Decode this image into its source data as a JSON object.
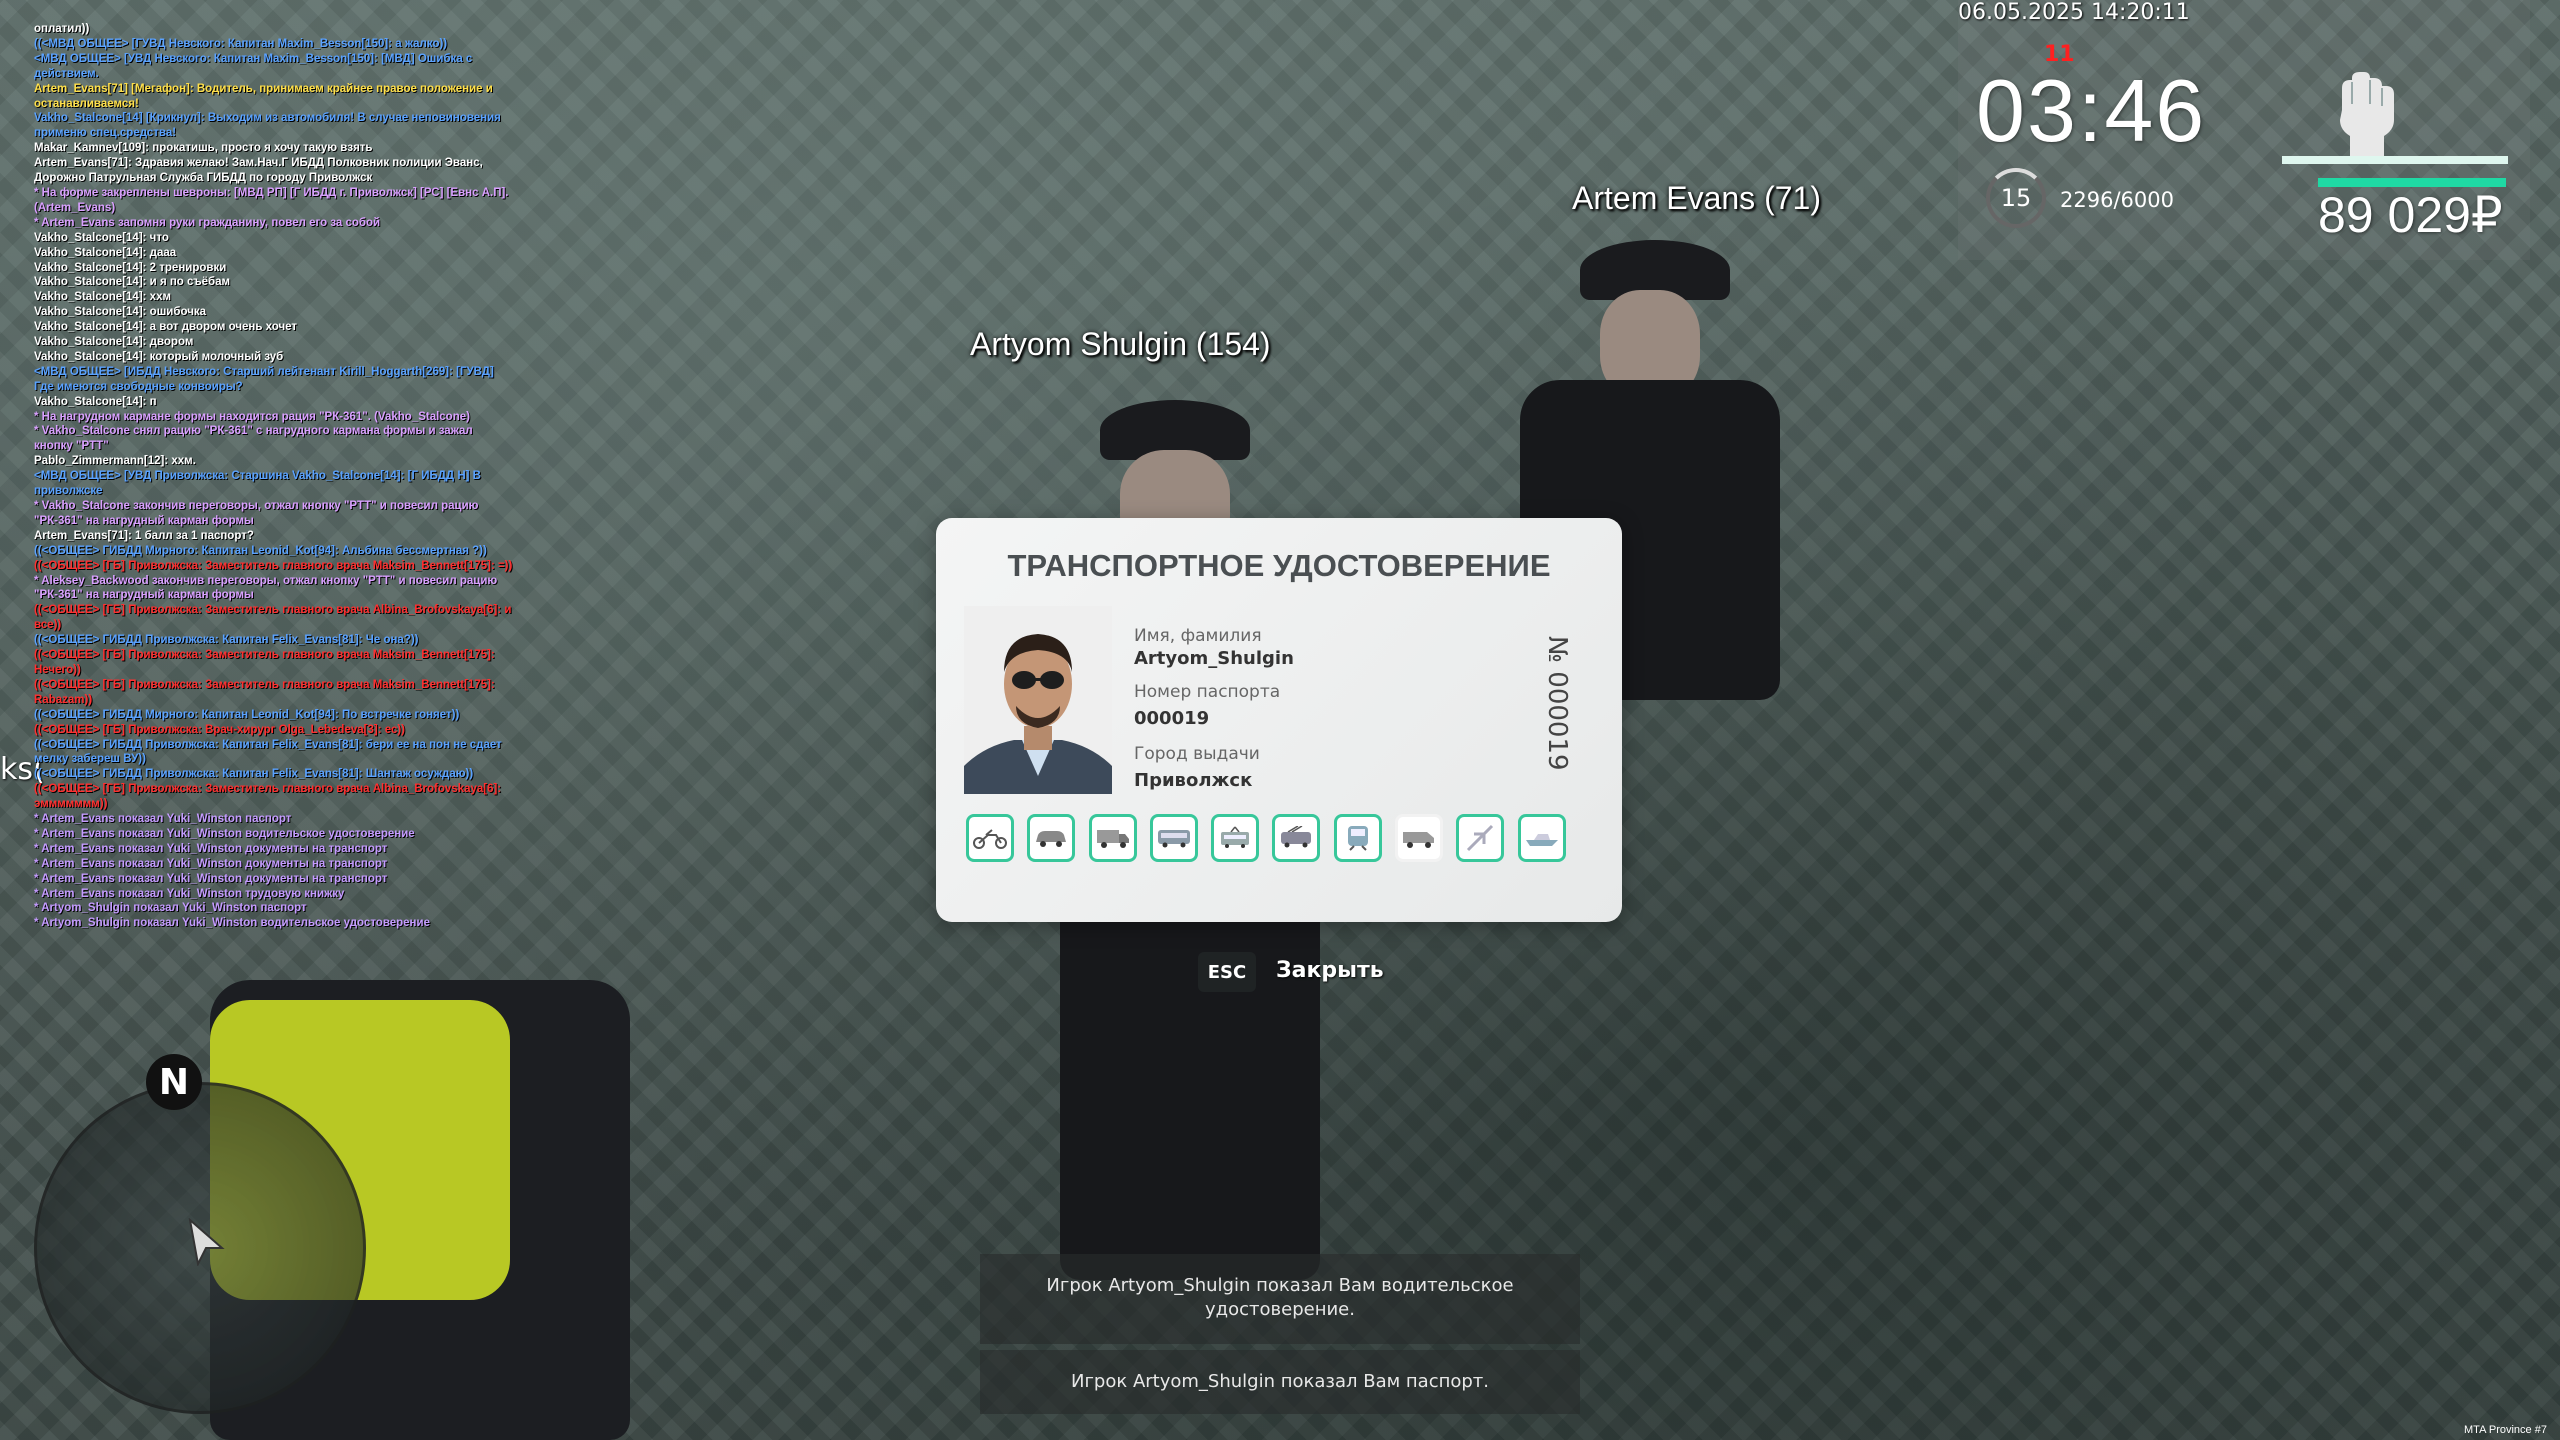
{
  "hud": {
    "datetime": "06.05.2025 14:20:11",
    "alert": "11",
    "clock": "03:46",
    "level": "15",
    "exp": "2296/6000",
    "money": "89 029₽",
    "accent_color": "#1fd9a4"
  },
  "players": [
    {
      "name": "Artyom Shulgin (154)"
    },
    {
      "name": "Artem Evans (71)"
    }
  ],
  "stray_text": "ks(",
  "chat": [
    {
      "c": "white",
      "t": "оплатил))"
    },
    {
      "c": "blue",
      "t": "((<МВД ОБЩЕЕ> [ГУВД Невского: Капитан Maxim_Besson[150]: а жалко))"
    },
    {
      "c": "blue",
      "t": "<МВД ОБЩЕЕ> [УВД Невского: Капитан Maxim_Besson[150]: [МВД] Ошибка с действием."
    },
    {
      "c": "yellow",
      "t": "Artem_Evans[71] [Мегафон]: Водитель, принимаем крайнее правое положение и останавливаемся!"
    },
    {
      "c": "blue",
      "t": "Vakho_Stalcone[14] [Крикнул]: Выходим из автомобиля! В случае неповиновения применю спец.средства!"
    },
    {
      "c": "white",
      "t": "Makar_Kamnev[109]: прокатишь, просто я хочу такую взять"
    },
    {
      "c": "white",
      "t": "Artem_Evans[71]: Здравия желаю! Зам.Нач.Г ИБДД Полковник полиции Эванс, Дорожно Патрульная Служба ГИБДД по городу Приволжск"
    },
    {
      "c": "pink",
      "t": "* На форме закреплены шевроны: [МВД РП] [Г ИБДД г. Приволжск] [РС] [Евнс А.П]. (Artem_Evans)"
    },
    {
      "c": "pink",
      "t": "* Artem_Evans запомня руки гражданину, повел его за собой"
    },
    {
      "c": "white",
      "t": "Vakho_Stalcone[14]: что"
    },
    {
      "c": "white",
      "t": "Vakho_Stalcone[14]: дааа"
    },
    {
      "c": "white",
      "t": "Vakho_Stalcone[14]: 2 тренировки"
    },
    {
      "c": "white",
      "t": "Vakho_Stalcone[14]: и я по съёбам"
    },
    {
      "c": "white",
      "t": "Vakho_Stalcone[14]: ххм"
    },
    {
      "c": "white",
      "t": "Vakho_Stalcone[14]: ошибочка"
    },
    {
      "c": "white",
      "t": "Vakho_Stalcone[14]: а вот двором очень хочет"
    },
    {
      "c": "white",
      "t": "Vakho_Stalcone[14]: двором"
    },
    {
      "c": "white",
      "t": "Vakho_Stalcone[14]: который молочный зуб"
    },
    {
      "c": "blue",
      "t": "<МВД ОБЩЕЕ> [ИБДД Невского: Старший лейтенант Kirill_Hoggarth[269]: [ГУВД] Где имеются свободные конвоиры?"
    },
    {
      "c": "white",
      "t": "Vakho_Stalcone[14]: п"
    },
    {
      "c": "pink",
      "t": "* На нагрудном кармане формы находится рация \"РК-361\". (Vakho_Stalcone)"
    },
    {
      "c": "pink",
      "t": "* Vakho_Stalcone снял рацию \"РК-361\" с нагрудного кармана формы и зажал кнопку \"PTT\""
    },
    {
      "c": "white",
      "t": "Pablo_Zimmermann[12]: ххм."
    },
    {
      "c": "blue",
      "t": "<МВД ОБЩЕЕ> [УВД Приволжска: Старшина Vakho_Stalcone[14]: [Г ИБДД Н] В приволжске"
    },
    {
      "c": "pink",
      "t": "* Vakho_Stalcone закончив переговоры, отжал кнопку \"PTT\" и повесил рацию \"РК-361\" на нагрудный карман формы"
    },
    {
      "c": "white",
      "t": "Artem_Evans[71]: 1 балл за 1 паспорт?"
    },
    {
      "c": "blue",
      "t": "((<ОБЩЕЕ> ГИБДД Мирного: Капитан Leonid_Kot[94]: Альбина бессмертная ?))"
    },
    {
      "c": "red",
      "t": "((<ОБЩЕЕ> [ГБ] Приволжска: Заместитель главного врача Maksim_Bennett[175]: =))"
    },
    {
      "c": "pink",
      "t": "* Aleksey_Backwood закончив переговоры, отжал кнопку \"PTT\" и повесил рацию \"РК-361\" на нагрудный карман формы"
    },
    {
      "c": "red",
      "t": "((<ОБЩЕЕ> [ГБ] Приволжска: Заместитель главного врача Albina_Brofovskaya[6]: и все))"
    },
    {
      "c": "blue",
      "t": "((<ОБЩЕЕ> ГИБДД Приволжска: Капитан Felix_Evans[81]: Че она?))"
    },
    {
      "c": "red",
      "t": "((<ОБЩЕЕ> [ГБ] Приволжска: Заместитель главного врача Maksim_Bennett[175]: Нечего))"
    },
    {
      "c": "red",
      "t": "((<ОБЩЕЕ> [ГБ] Приволжска: Заместитель главного врача Maksim_Bennett[175]: Rabazam))"
    },
    {
      "c": "blue",
      "t": "((<ОБЩЕЕ> ГИБДД Мирного: Капитан Leonid_Kot[94]: По встречке гоняет))"
    },
    {
      "c": "red",
      "t": "((<ОБЩЕЕ> [ГБ] Приволжска: Врач-хирург Olga_Lebedeva[3]: ес))"
    },
    {
      "c": "blue",
      "t": "((<ОБЩЕЕ> ГИБДД Приволжска: Капитан Felix_Evans[81]: бери ее на пон не сдает мелку забереш ВУ))"
    },
    {
      "c": "blue",
      "t": "((<ОБЩЕЕ> ГИБДД Приволжска: Капитан Felix_Evans[81]: Шантаж осуждаю))"
    },
    {
      "c": "red",
      "t": "((<ОБЩЕЕ> [ГБ] Приволжска: Заместитель главного врача Albina_Brofovskaya[6]: эммммммм))"
    },
    {
      "c": "lav",
      "t": "* Artem_Evans показал Yuki_Winston паспорт"
    },
    {
      "c": "lav",
      "t": "* Artem_Evans показал Yuki_Winston водительское удостоверение"
    },
    {
      "c": "lav",
      "t": "* Artem_Evans показал Yuki_Winston документы на транспорт"
    },
    {
      "c": "lav",
      "t": "* Artem_Evans показал Yuki_Winston документы на транспорт"
    },
    {
      "c": "lav",
      "t": "* Artem_Evans показал Yuki_Winston документы на транспорт"
    },
    {
      "c": "lav",
      "t": "* Artem_Evans показал Yuki_Winston трудовую книжку"
    },
    {
      "c": "lav",
      "t": "* Artyom_Shulgin показал Yuki_Winston паспорт"
    },
    {
      "c": "lav",
      "t": "* Artyom_Shulgin показал Yuki_Winston водительское удостоверение"
    }
  ],
  "minimap": {
    "north": "N"
  },
  "card": {
    "title": "ТРАНСПОРТНОЕ УДОСТОВЕРЕНИЕ",
    "name_label": "Имя, фамилия",
    "name_value": "Artyom_Shulgin",
    "passport_label": "Номер паспорта",
    "passport_value": "000019",
    "city_label": "Город выдачи",
    "city_value": "Приволжск",
    "number": "№ 000019",
    "categories": [
      {
        "icon": "motorcycle-icon",
        "active": true
      },
      {
        "icon": "car-icon",
        "active": true
      },
      {
        "icon": "truck-icon",
        "active": true
      },
      {
        "icon": "bus-icon",
        "active": true
      },
      {
        "icon": "tram-icon",
        "active": true
      },
      {
        "icon": "trolleybus-icon",
        "active": true
      },
      {
        "icon": "train-icon",
        "active": true
      },
      {
        "icon": "van-icon",
        "active": false
      },
      {
        "icon": "plane-icon",
        "active": true
      },
      {
        "icon": "boat-icon",
        "active": true
      }
    ]
  },
  "close": {
    "key": "ESC",
    "label": "Закрыть"
  },
  "notices": [
    "Игрок Artyom_Shulgin показал Вам водительское удостоверение.",
    "Игрок Artyom_Shulgin показал Вам паспорт."
  ],
  "version": "MTA Province #7"
}
